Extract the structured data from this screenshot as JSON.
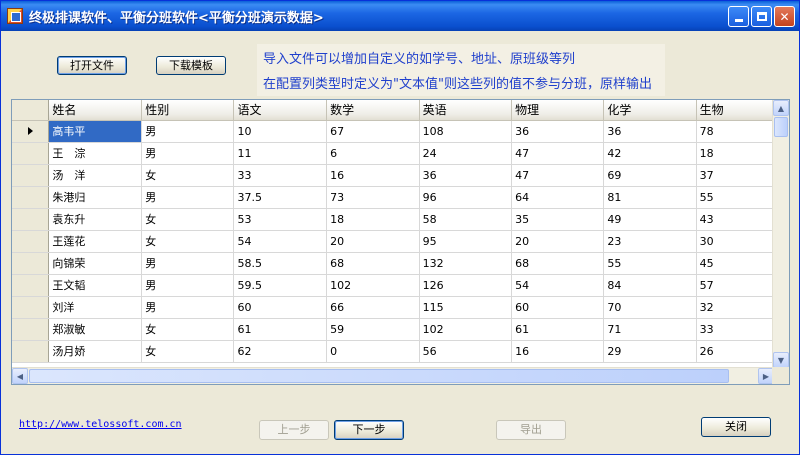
{
  "window": {
    "title": "终极排课软件、平衡分班软件<平衡分班演示数据>"
  },
  "toolbar": {
    "open_file": "打开文件",
    "download_template": "下载模板"
  },
  "hints": {
    "line1": "导入文件可以增加自定义的如学号、地址、原班级等列",
    "line2": "在配置列类型时定义为\"文本值\"则这些列的值不参与分班，原样输出"
  },
  "grid": {
    "columns": [
      "姓名",
      "性别",
      "语文",
      "数学",
      "英语",
      "物理",
      "化学",
      "生物"
    ],
    "rows": [
      [
        "高韦平",
        "男",
        "10",
        "67",
        "108",
        "36",
        "36",
        "78"
      ],
      [
        "王　淙",
        "男",
        "11",
        "6",
        "24",
        "47",
        "42",
        "18"
      ],
      [
        "汤　洋",
        "女",
        "33",
        "16",
        "36",
        "47",
        "69",
        "37"
      ],
      [
        "朱港归",
        "男",
        "37.5",
        "73",
        "96",
        "64",
        "81",
        "55"
      ],
      [
        "袁东升",
        "女",
        "53",
        "18",
        "58",
        "35",
        "49",
        "43"
      ],
      [
        "王莲花",
        "女",
        "54",
        "20",
        "95",
        "20",
        "23",
        "30"
      ],
      [
        "向锦荣",
        "男",
        "58.5",
        "68",
        "132",
        "68",
        "55",
        "45"
      ],
      [
        "王文韬",
        "男",
        "59.5",
        "102",
        "126",
        "54",
        "84",
        "57"
      ],
      [
        "刘洋",
        "男",
        "60",
        "66",
        "115",
        "60",
        "70",
        "32"
      ],
      [
        "郑淑敏",
        "女",
        "61",
        "59",
        "102",
        "61",
        "71",
        "33"
      ],
      [
        "汤月娇",
        "女",
        "62",
        "0",
        "56",
        "16",
        "29",
        "26"
      ]
    ],
    "selected_cell": "高韦平"
  },
  "footer": {
    "url": "http://www.telossoft.com.cn",
    "prev": "上一步",
    "next": "下一步",
    "export": "导出",
    "close": "关闭"
  }
}
